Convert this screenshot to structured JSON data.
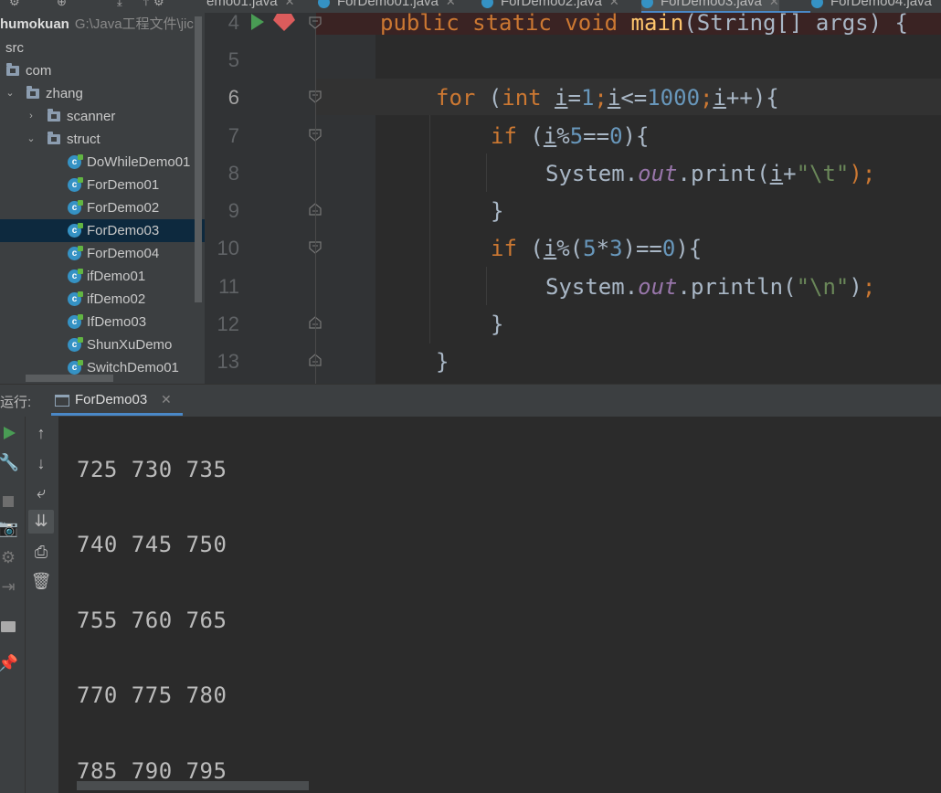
{
  "project": {
    "name": "humokuan",
    "path": "G:\\Java工程文件\\jic",
    "tree": [
      {
        "label": "src"
      },
      {
        "label": "com"
      },
      {
        "label": "zhang"
      },
      {
        "label": "scanner"
      },
      {
        "label": "struct"
      },
      {
        "label": "DoWhileDemo01"
      },
      {
        "label": "ForDemo01"
      },
      {
        "label": "ForDemo02"
      },
      {
        "label": "ForDemo03"
      },
      {
        "label": "ForDemo04"
      },
      {
        "label": "ifDemo01"
      },
      {
        "label": "ifDemo02"
      },
      {
        "label": "IfDemo03"
      },
      {
        "label": "ShunXuDemo"
      },
      {
        "label": "SwitchDemo01"
      }
    ]
  },
  "tabs": [
    {
      "label": "emo01.java"
    },
    {
      "label": "ForDemo01.java"
    },
    {
      "label": "ForDemo02.java"
    },
    {
      "label": "ForDemo03.java"
    },
    {
      "label": "ForDemo04.java"
    }
  ],
  "editor": {
    "line_numbers": [
      "4",
      "5",
      "6",
      "7",
      "8",
      "9",
      "10",
      "11",
      "12",
      "13"
    ],
    "current_line": "6"
  },
  "run": {
    "label": "运行:",
    "tab": "ForDemo03",
    "output": [
      "725 730 735",
      "740 745 750",
      "755 760 765",
      "770 775 780",
      "785 790 795"
    ]
  },
  "colors": {
    "keyword": "#cc7832",
    "number": "#6897bb",
    "string": "#6a8759",
    "method": "#ffc66d",
    "field": "#9876aa",
    "selection": "#0d293e",
    "accent": "#4a88c7"
  }
}
